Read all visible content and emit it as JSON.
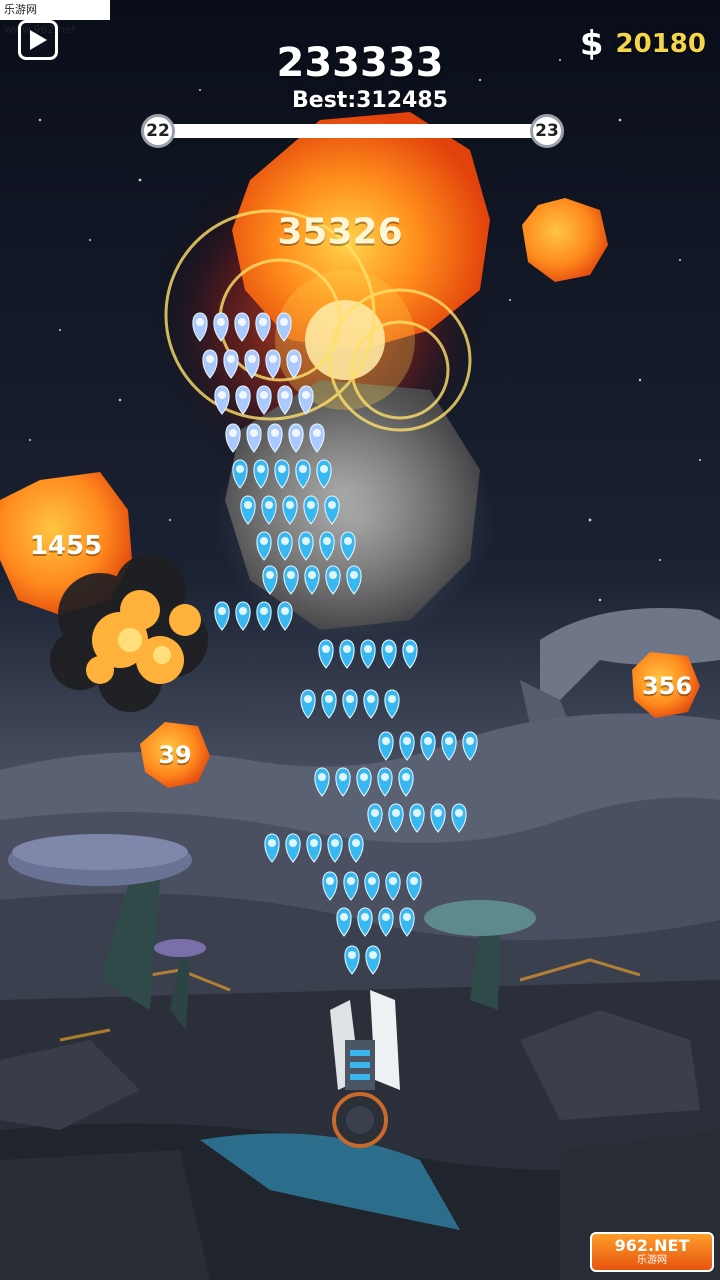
{
  "watermark": {
    "text": "乐游网 www.962.net"
  },
  "hud": {
    "score": "233333",
    "best": "Best:312485",
    "currency_symbol": "$",
    "money": "20180",
    "level_current": "22",
    "level_next": "23",
    "level_progress": 1.0,
    "play_icon": "play-icon"
  },
  "targets": [
    {
      "id": "big-sun",
      "value": "35326"
    },
    {
      "id": "left-rock",
      "value": "1455"
    },
    {
      "id": "right-rock",
      "value": "356"
    },
    {
      "id": "small-rock",
      "value": "39"
    }
  ],
  "logo": {
    "line1": "962.NET",
    "line2": "乐游网"
  },
  "colors": {
    "money": "#f6d54a",
    "bullet": "#38b8f2",
    "fireball": "#ff8a1e",
    "sky": "#0b0f1c"
  }
}
